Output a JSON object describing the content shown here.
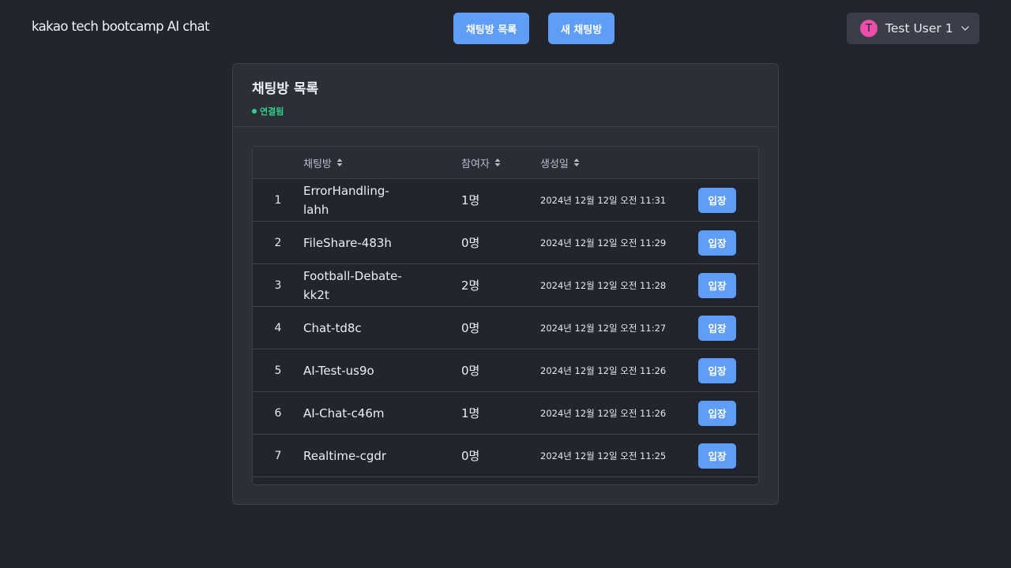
{
  "header": {
    "logo": "kakao tech bootcamp AI chat",
    "rooms_button": "채팅방 목록",
    "new_room_button": "새 채팅방",
    "user": {
      "initial": "T",
      "name": "Test User 1"
    }
  },
  "card": {
    "title": "채팅방 목록",
    "status": "연결됨"
  },
  "table": {
    "columns": {
      "room": "채팅방",
      "participants": "참여자",
      "created": "생성일"
    },
    "rows": [
      {
        "num": "1",
        "name": "ErrorHandling-lahh",
        "participants": "1명",
        "created": "2024년 12월 12일 오전 11:31",
        "action": "입장"
      },
      {
        "num": "2",
        "name": "FileShare-483h",
        "participants": "0명",
        "created": "2024년 12월 12일 오전 11:29",
        "action": "입장"
      },
      {
        "num": "3",
        "name": "Football-Debate-kk2t",
        "participants": "2명",
        "created": "2024년 12월 12일 오전 11:28",
        "action": "입장"
      },
      {
        "num": "4",
        "name": "Chat-td8c",
        "participants": "0명",
        "created": "2024년 12월 12일 오전 11:27",
        "action": "입장"
      },
      {
        "num": "5",
        "name": "AI-Test-us9o",
        "participants": "0명",
        "created": "2024년 12월 12일 오전 11:26",
        "action": "입장"
      },
      {
        "num": "6",
        "name": "AI-Chat-c46m",
        "participants": "1명",
        "created": "2024년 12월 12일 오전 11:26",
        "action": "입장"
      },
      {
        "num": "7",
        "name": "Realtime-cgdr",
        "participants": "0명",
        "created": "2024년 12월 12일 오전 11:25",
        "action": "입장"
      }
    ]
  },
  "icons": {
    "sort": "sort-icon",
    "chevron": "chevron-down-icon"
  },
  "colors": {
    "accent": "#5e9ef7",
    "status": "#2fd08a",
    "avatar": "#ec4fab",
    "background": "#22252d"
  }
}
